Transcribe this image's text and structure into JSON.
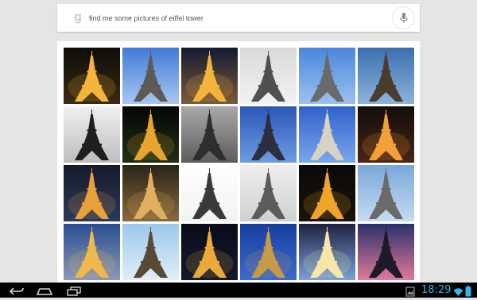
{
  "search": {
    "query": "find me some pictures of eiffel tower",
    "logo_letter": "g",
    "mic_icon": "microphone-icon"
  },
  "results": [
    {
      "bg": [
        "#0d0c0a",
        "#3a2a12"
      ],
      "tower": "#f5b53a",
      "lit": true
    },
    {
      "bg": [
        "#3f7bd8",
        "#a9c7ee"
      ],
      "tower": "#5d5a55",
      "lit": false
    },
    {
      "bg": [
        "#131a33",
        "#7b5a3a"
      ],
      "tower": "#f2b43a",
      "lit": true
    },
    {
      "bg": [
        "#d9d9d9",
        "#f2f2f2"
      ],
      "tower": "#505050",
      "lit": false
    },
    {
      "bg": [
        "#4a86dc",
        "#9cc1f0"
      ],
      "tower": "#6a6a6a",
      "lit": false
    },
    {
      "bg": [
        "#3a6fb0",
        "#8db3da"
      ],
      "tower": "#4a3c2c",
      "lit": false
    },
    {
      "bg": [
        "#f0f0f0",
        "#bdbdbd"
      ],
      "tower": "#1e1e1e",
      "lit": false
    },
    {
      "bg": [
        "#050505",
        "#203015"
      ],
      "tower": "#e7a42e",
      "lit": true
    },
    {
      "bg": [
        "#a9a9a9",
        "#5c5c5c"
      ],
      "tower": "#2e2e2e",
      "lit": false
    },
    {
      "bg": [
        "#2b57b9",
        "#6f9be0"
      ],
      "tower": "#2b2f3f",
      "lit": false
    },
    {
      "bg": [
        "#2f62c9",
        "#7aa6ee"
      ],
      "tower": "#d9d2c0",
      "lit": false
    },
    {
      "bg": [
        "#120d0a",
        "#4a2614"
      ],
      "tower": "#f2a03a",
      "lit": true
    },
    {
      "bg": [
        "#161a2a",
        "#2b3a5a"
      ],
      "tower": "#e9a23a",
      "lit": true
    },
    {
      "bg": [
        "#2a2418",
        "#8a6a3a"
      ],
      "tower": "#e0b060",
      "lit": true
    },
    {
      "bg": [
        "#ffffff",
        "#f2f2f2"
      ],
      "tower": "#3a3a3a",
      "lit": false
    },
    {
      "bg": [
        "#efefef",
        "#cfcfcf"
      ],
      "tower": "#5b5b5b",
      "lit": false
    },
    {
      "bg": [
        "#0a0a0a",
        "#1a1206"
      ],
      "tower": "#f0a428",
      "lit": true
    },
    {
      "bg": [
        "#79a7d9",
        "#c6dcf2"
      ],
      "tower": "#6a6a6a",
      "lit": false
    },
    {
      "bg": [
        "#2a4e90",
        "#8a9ab8"
      ],
      "tower": "#f0b84a",
      "lit": true
    },
    {
      "bg": [
        "#9ec8ec",
        "#e0eef8"
      ],
      "tower": "#5a4a35",
      "lit": false
    },
    {
      "bg": [
        "#080b18",
        "#141a30"
      ],
      "tower": "#e9aa3a",
      "lit": true
    },
    {
      "bg": [
        "#173f9e",
        "#3b6ad0"
      ],
      "tower": "#c79a45",
      "lit": true
    },
    {
      "bg": [
        "#1e2240",
        "#7aa0d8"
      ],
      "tower": "#f6e7a8",
      "lit": true
    },
    {
      "bg": [
        "#2a2f6a",
        "#e07a9a"
      ],
      "tower": "#1e1a2a",
      "lit": false
    }
  ],
  "statusbar": {
    "time": "18:29",
    "clock_color": "#33b5e5",
    "icons": [
      "back-icon",
      "home-icon",
      "recent-apps-icon",
      "screenshot-icon",
      "wifi-icon",
      "battery-icon"
    ]
  }
}
